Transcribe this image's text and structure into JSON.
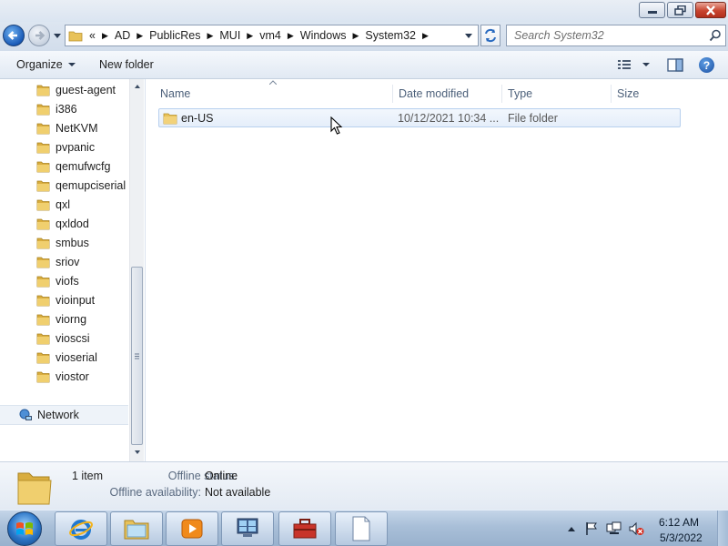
{
  "addressbar": {
    "overflow": "«",
    "crumbs": [
      "AD",
      "PublicRes",
      "MUI",
      "vm4",
      "Windows",
      "System32"
    ]
  },
  "search": {
    "placeholder": "Search System32"
  },
  "toolbar": {
    "organize_label": "Organize",
    "newfolder_label": "New folder"
  },
  "navpane": {
    "items": [
      "guest-agent",
      "i386",
      "NetKVM",
      "pvpanic",
      "qemufwcfg",
      "qemupciserial",
      "qxl",
      "qxldod",
      "smbus",
      "sriov",
      "viofs",
      "vioinput",
      "viorng",
      "vioscsi",
      "vioserial",
      "viostor"
    ],
    "network_label": "Network"
  },
  "columns": {
    "name": "Name",
    "date": "Date modified",
    "type": "Type",
    "size": "Size"
  },
  "file": {
    "name": "en-US",
    "date": "10/12/2021 10:34 ...",
    "type": "File folder"
  },
  "details": {
    "count": "1 item",
    "status_label": "Offline status:",
    "status_value": "Online",
    "availability_label": "Offline availability:",
    "availability_value": "Not available"
  },
  "clock": {
    "time": "6:12 AM",
    "date": "5/3/2022"
  },
  "colors": {
    "folder": "#e8c25a",
    "accent": "#1a5bb8",
    "selection": "#e5eefa"
  }
}
